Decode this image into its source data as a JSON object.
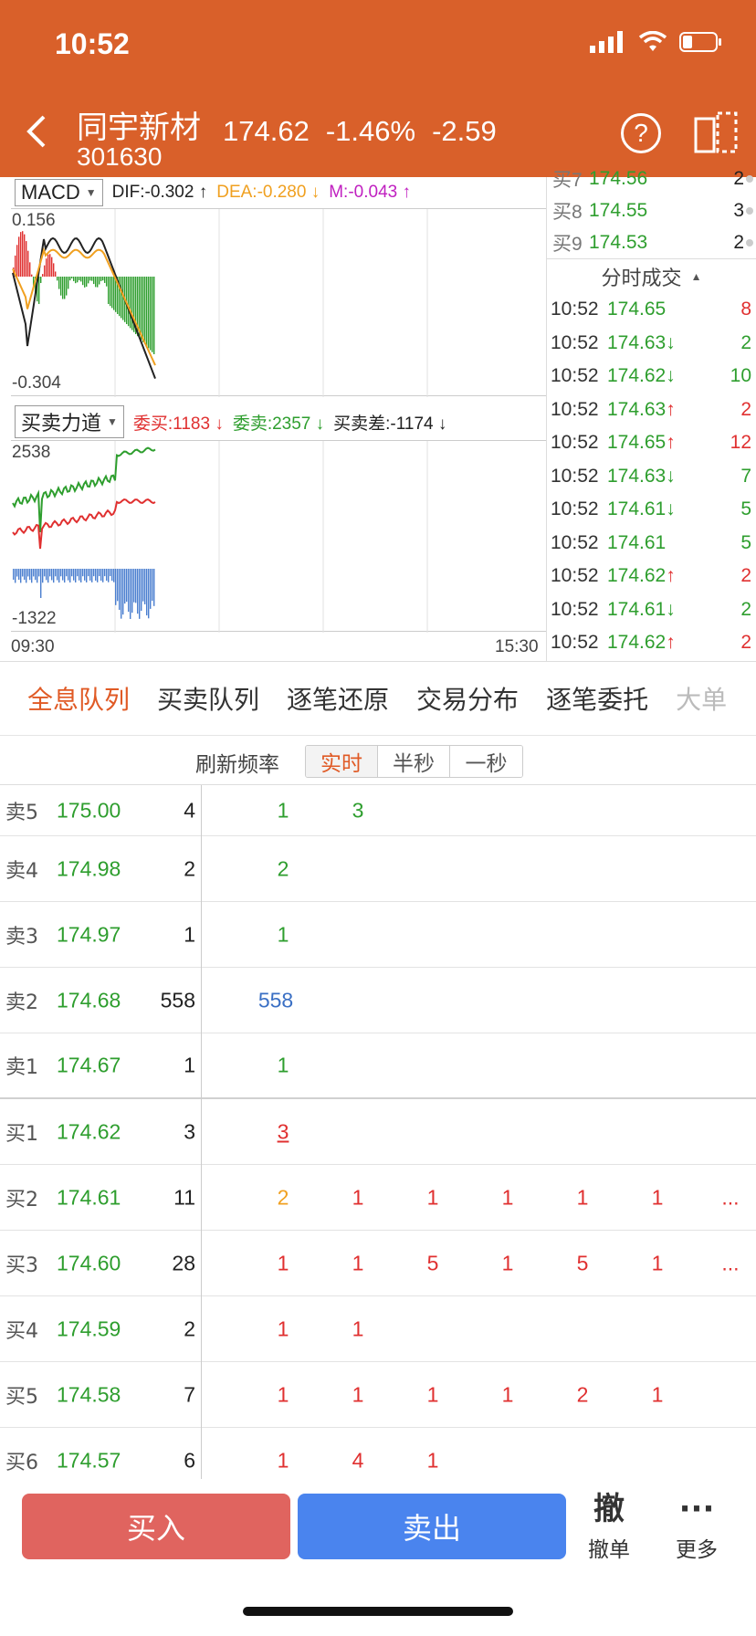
{
  "status": {
    "time": "10:52"
  },
  "stock": {
    "name": "同宇新材",
    "code": "301630",
    "price": "174.62",
    "pct": "-1.46%",
    "change": "-2.59"
  },
  "header": {
    "help_label": "?"
  },
  "macd": {
    "selector": "MACD",
    "dif": "DIF:-0.302 ↑",
    "dea": "DEA:-0.280 ↓",
    "m": "M:-0.043 ↑",
    "ymax": "0.156",
    "ymin": "-0.304",
    "colors": {
      "dif": "#222222",
      "dea": "#f0a020",
      "m": "#c020c0"
    }
  },
  "force": {
    "selector": "买卖力道",
    "buy": "委买:1183 ↓",
    "sell": "委卖:2357 ↓",
    "diff": "买卖差:-1174 ↓",
    "ymax": "2538",
    "ymin": "-1322",
    "time_start": "09:30",
    "time_end": "15:30"
  },
  "order_book": [
    {
      "label": "买7",
      "price": "174.56",
      "vol": "2"
    },
    {
      "label": "买8",
      "price": "174.55",
      "vol": "3"
    },
    {
      "label": "买9",
      "price": "174.53",
      "vol": "2"
    }
  ],
  "trades_title": "分时成交",
  "trades": [
    {
      "time": "10:52",
      "price": "174.65",
      "arrow": "",
      "vol": "8",
      "color": "#e03030"
    },
    {
      "time": "10:52",
      "price": "174.63",
      "arrow": "↓",
      "vol": "2",
      "color": "#2e9e2e"
    },
    {
      "time": "10:52",
      "price": "174.62",
      "arrow": "↓",
      "vol": "10",
      "color": "#2e9e2e"
    },
    {
      "time": "10:52",
      "price": "174.63",
      "arrow": "↑",
      "vol": "2",
      "color": "#e03030"
    },
    {
      "time": "10:52",
      "price": "174.65",
      "arrow": "↑",
      "vol": "12",
      "color": "#e03030"
    },
    {
      "time": "10:52",
      "price": "174.63",
      "arrow": "↓",
      "vol": "7",
      "color": "#2e9e2e"
    },
    {
      "time": "10:52",
      "price": "174.61",
      "arrow": "↓",
      "vol": "5",
      "color": "#2e9e2e"
    },
    {
      "time": "10:52",
      "price": "174.61",
      "arrow": "",
      "vol": "5",
      "color": "#2e9e2e"
    },
    {
      "time": "10:52",
      "price": "174.62",
      "arrow": "↑",
      "vol": "2",
      "color": "#e03030"
    },
    {
      "time": "10:52",
      "price": "174.61",
      "arrow": "↓",
      "vol": "2",
      "color": "#2e9e2e"
    },
    {
      "time": "10:52",
      "price": "174.62",
      "arrow": "↑",
      "vol": "2",
      "color": "#e03030"
    }
  ],
  "tabs": [
    "全息队列",
    "买卖队列",
    "逐笔还原",
    "交易分布",
    "逐笔委托",
    "大单"
  ],
  "refresh": {
    "label": "刷新频率",
    "options": [
      "实时",
      "半秒",
      "一秒"
    ]
  },
  "queue": [
    {
      "label": "卖5",
      "price": "175.00",
      "vol": "4",
      "cells": [
        {
          "v": "1",
          "c": "#2e9e2e"
        },
        {
          "v": "3",
          "c": "#2e9e2e"
        }
      ]
    },
    {
      "label": "卖4",
      "price": "174.98",
      "vol": "2",
      "cells": [
        {
          "v": "2",
          "c": "#2e9e2e"
        }
      ]
    },
    {
      "label": "卖3",
      "price": "174.97",
      "vol": "1",
      "cells": [
        {
          "v": "1",
          "c": "#2e9e2e"
        }
      ]
    },
    {
      "label": "卖2",
      "price": "174.68",
      "vol": "558",
      "cells": [
        {
          "v": "558",
          "c": "#3a6fc4"
        }
      ]
    },
    {
      "label": "卖1",
      "price": "174.67",
      "vol": "1",
      "cells": [
        {
          "v": "1",
          "c": "#2e9e2e"
        }
      ]
    },
    {
      "label": "买1",
      "price": "174.62",
      "vol": "3",
      "cells": [
        {
          "v": "3",
          "c": "#e03030",
          "u": true
        }
      ]
    },
    {
      "label": "买2",
      "price": "174.61",
      "vol": "11",
      "cells": [
        {
          "v": "2",
          "c": "#f0a020"
        },
        {
          "v": "1",
          "c": "#e03030"
        },
        {
          "v": "1",
          "c": "#e03030"
        },
        {
          "v": "1",
          "c": "#e03030"
        },
        {
          "v": "1",
          "c": "#e03030"
        },
        {
          "v": "1",
          "c": "#e03030"
        },
        {
          "v": "...",
          "c": "#e03030"
        }
      ]
    },
    {
      "label": "买3",
      "price": "174.60",
      "vol": "28",
      "cells": [
        {
          "v": "1",
          "c": "#e03030"
        },
        {
          "v": "1",
          "c": "#e03030"
        },
        {
          "v": "5",
          "c": "#e03030"
        },
        {
          "v": "1",
          "c": "#e03030"
        },
        {
          "v": "5",
          "c": "#e03030"
        },
        {
          "v": "1",
          "c": "#e03030"
        },
        {
          "v": "...",
          "c": "#e03030"
        }
      ]
    },
    {
      "label": "买4",
      "price": "174.59",
      "vol": "2",
      "cells": [
        {
          "v": "1",
          "c": "#e03030"
        },
        {
          "v": "1",
          "c": "#e03030"
        }
      ]
    },
    {
      "label": "买5",
      "price": "174.58",
      "vol": "7",
      "cells": [
        {
          "v": "1",
          "c": "#e03030"
        },
        {
          "v": "1",
          "c": "#e03030"
        },
        {
          "v": "1",
          "c": "#e03030"
        },
        {
          "v": "1",
          "c": "#e03030"
        },
        {
          "v": "2",
          "c": "#e03030"
        },
        {
          "v": "1",
          "c": "#e03030"
        }
      ]
    },
    {
      "label": "买6",
      "price": "174.57",
      "vol": "6",
      "cells": [
        {
          "v": "1",
          "c": "#e03030"
        },
        {
          "v": "4",
          "c": "#e03030"
        },
        {
          "v": "1",
          "c": "#e03030"
        }
      ]
    }
  ],
  "actions": {
    "buy": "买入",
    "sell": "卖出",
    "cancel_icon": "撤",
    "cancel": "撤单",
    "more_icon": "···",
    "more": "更多"
  }
}
